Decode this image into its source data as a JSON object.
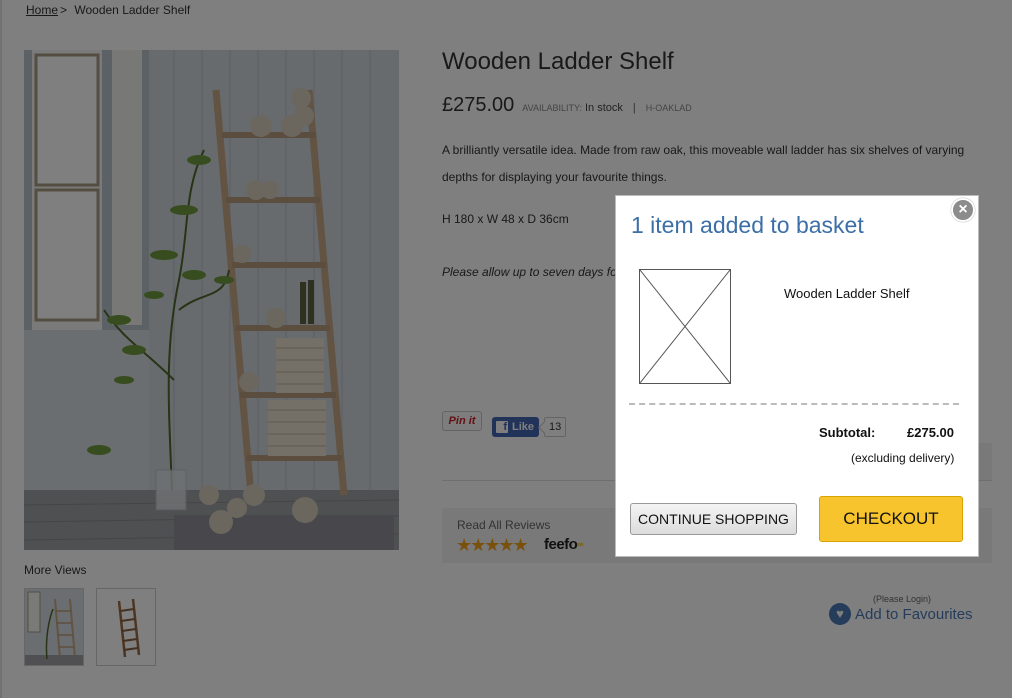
{
  "breadcrumb": {
    "home": "Home",
    "separator": ">",
    "current": "Wooden Ladder Shelf"
  },
  "product": {
    "title": "Wooden Ladder Shelf",
    "price": "£275.00",
    "availability_label": "AVAILABILITY:",
    "availability_value": "In stock",
    "separator": "|",
    "sku": "H-OAKLAD",
    "description": "A brilliantly versatile idea. Made from raw oak, this moveable wall ladder has six shelves of varying depths for displaying your favourite things.",
    "dimensions": "H 180 x W 48 x D 36cm",
    "delivery_notice": "Please allow up to seven days fo on this item. As this item is delive carefully before signing for it. Ple"
  },
  "gallery": {
    "more_views_label": "More Views"
  },
  "social": {
    "pinit_label": "Pin it",
    "fb_icon": "f",
    "like_label": "Like",
    "like_count": "13"
  },
  "reviews": {
    "label": "Read All Reviews",
    "stars": "★★★★★",
    "rating": 5,
    "brand": "feefo",
    "brand_mark": "ºº"
  },
  "favourites": {
    "login_note": "(Please Login)",
    "label": "Add to Favourites",
    "icon": "heart-icon"
  },
  "modal": {
    "title": "1 item added to basket",
    "close": "×",
    "item_name": "Wooden Ladder Shelf",
    "subtotal_label": "Subtotal:",
    "subtotal_value": "£275.00",
    "delivery_note": "(excluding delivery)",
    "continue_label": "CONTINUE SHOPPING",
    "checkout_label": "CHECKOUT"
  },
  "colors": {
    "modal_title": "#3c6fa8",
    "checkout_button": "#f7c42d",
    "facebook": "#4267b2",
    "favourites": "#4a7ab5",
    "stars": "#f3a21a"
  }
}
